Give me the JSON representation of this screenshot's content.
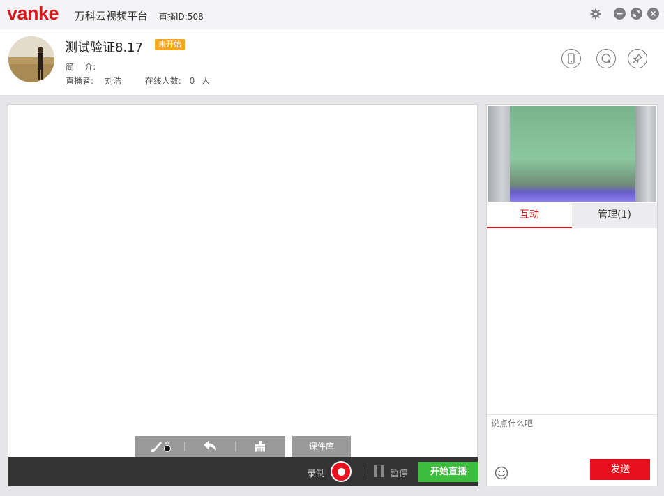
{
  "titlebar": {
    "logo_text": "vanke",
    "platform_name": "万科云视频平台",
    "live_id": "直播ID:508",
    "icons": [
      "gear-icon",
      "minimize-icon",
      "maximize-icon",
      "close-icon"
    ]
  },
  "header": {
    "title": "测试验证8.17",
    "status": "未开始",
    "intro_label": "简    介:",
    "intro_value": "",
    "host_label": "直播者:",
    "host_name": "刘浩",
    "online_label": "在线人数:",
    "online_count": "0",
    "online_unit": "人",
    "action_icons": [
      "mobile-icon",
      "chat-bubble-icon",
      "pin-icon"
    ]
  },
  "board": {
    "tools": [
      "brush-icon",
      "undo-icon",
      "eraser-icon"
    ],
    "courseware_label": "课件库"
  },
  "control_bar": {
    "record_label": "录制",
    "pause_label": "暂停",
    "start_label": "开始直播"
  },
  "right_panel": {
    "tabs": [
      {
        "label": "互动",
        "active": true
      },
      {
        "label": "管理(1)",
        "active": false
      }
    ],
    "chat_placeholder": "说点什么吧",
    "send_label": "发送"
  },
  "colors": {
    "brand": "#d9161c",
    "status_badge": "#f5a623",
    "start_button": "#3dbd3d",
    "record_button": "#e8101e"
  }
}
